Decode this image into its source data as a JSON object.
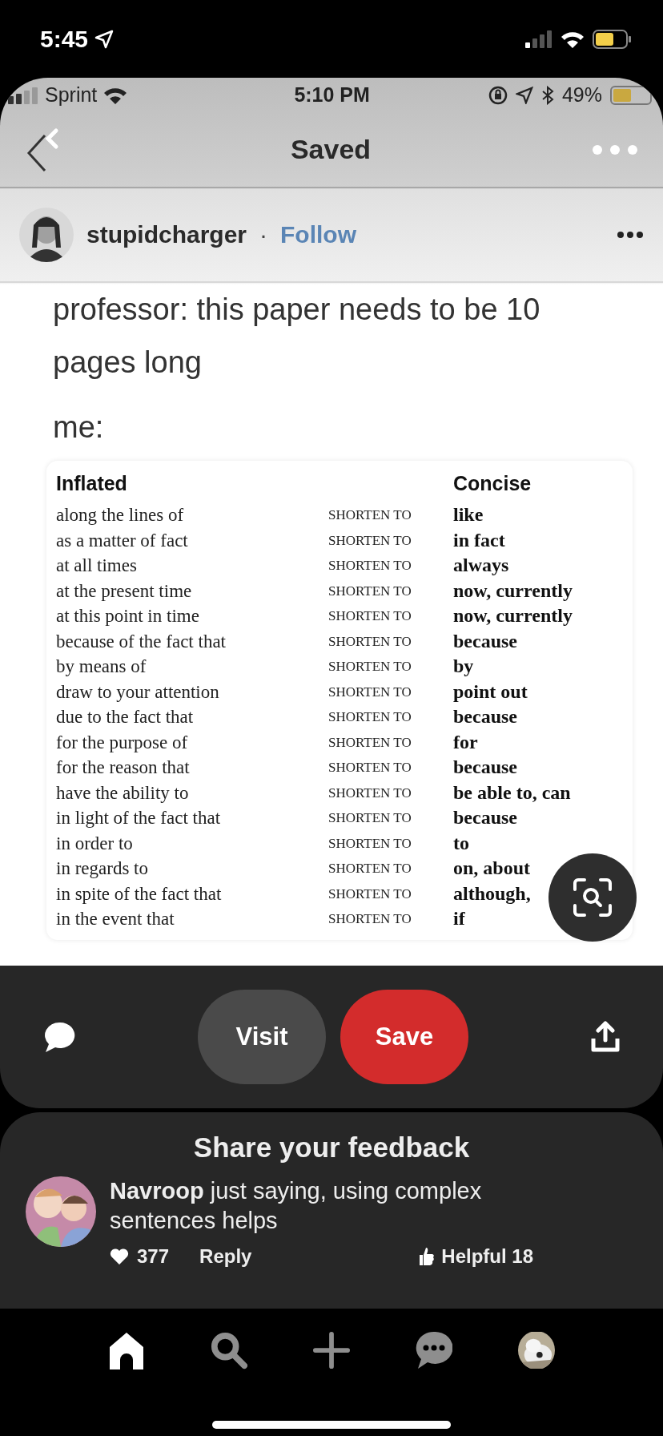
{
  "status_bar": {
    "time": "5:45"
  },
  "pin": {
    "inner_status_bar": {
      "carrier": "Sprint",
      "time": "5:10 PM",
      "battery": "49%"
    },
    "header": {
      "title": "Saved"
    },
    "author": {
      "name": "stupidcharger",
      "separator": "·",
      "follow": "Follow"
    },
    "caption": [
      "professor: this paper needs to be 10 pages long",
      "me:"
    ],
    "table": {
      "inflated_header": "Inflated",
      "concise_header": "Concise",
      "rows": [
        {
          "inflated": "along the lines of",
          "action": "SHORTEN TO",
          "concise": "like"
        },
        {
          "inflated": "as a matter of fact",
          "action": "SHORTEN TO",
          "concise": "in fact"
        },
        {
          "inflated": "at all times",
          "action": "SHORTEN TO",
          "concise": "always"
        },
        {
          "inflated": "at the present time",
          "action": "SHORTEN TO",
          "concise": "now, currently"
        },
        {
          "inflated": "at this point in time",
          "action": "SHORTEN TO",
          "concise": "now, currently"
        },
        {
          "inflated": "because of the fact that",
          "action": "SHORTEN TO",
          "concise": "because"
        },
        {
          "inflated": "by means of",
          "action": "SHORTEN TO",
          "concise": "by"
        },
        {
          "inflated": "draw to your attention",
          "action": "SHORTEN TO",
          "concise": "point out"
        },
        {
          "inflated": "due to the fact that",
          "action": "SHORTEN TO",
          "concise": "because"
        },
        {
          "inflated": "for the purpose of",
          "action": "SHORTEN TO",
          "concise": "for"
        },
        {
          "inflated": "for the reason that",
          "action": "SHORTEN TO",
          "concise": "because"
        },
        {
          "inflated": "have the ability to",
          "action": "SHORTEN TO",
          "concise": "be able to, can"
        },
        {
          "inflated": "in light of the fact that",
          "action": "SHORTEN TO",
          "concise": "because"
        },
        {
          "inflated": "in order to",
          "action": "SHORTEN TO",
          "concise": "to"
        },
        {
          "inflated": "in regards to",
          "action": "SHORTEN TO",
          "concise": "on, about"
        },
        {
          "inflated": "in spite of the fact that",
          "action": "SHORTEN TO",
          "concise": "although,"
        },
        {
          "inflated": "in the event that",
          "action": "SHORTEN TO",
          "concise": "if"
        }
      ]
    }
  },
  "actions": {
    "visit": "Visit",
    "save": "Save"
  },
  "feedback": {
    "title": "Share your feedback",
    "comment": {
      "text": "**Navroop** just saying, using complex sentences helps",
      "likes": "377",
      "reply": "Reply",
      "helpful": "Helpful 18"
    }
  },
  "bottom_nav": [
    {
      "kind": "home",
      "selected": true
    },
    {
      "kind": "search",
      "selected": false
    },
    {
      "kind": "create",
      "selected": false
    },
    {
      "kind": "messages",
      "selected": false
    },
    {
      "kind": "profile",
      "selected": false
    }
  ]
}
